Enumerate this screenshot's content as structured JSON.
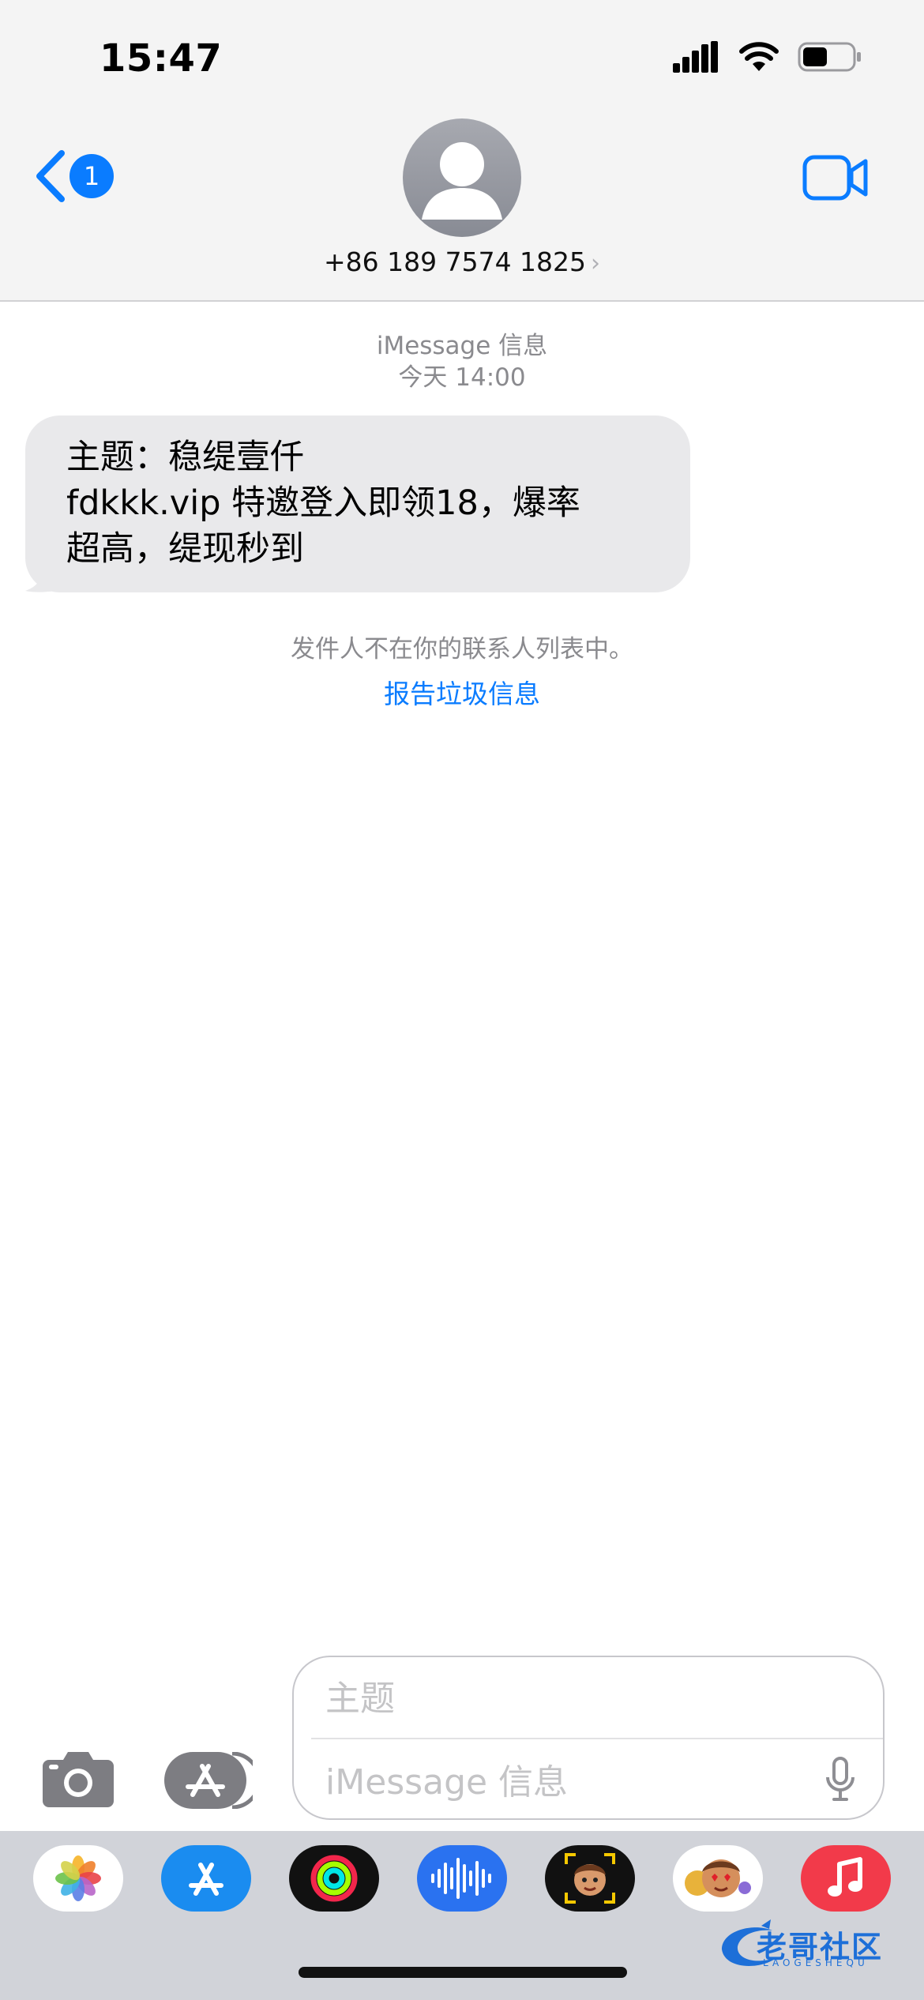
{
  "status": {
    "time": "15:47"
  },
  "nav": {
    "back_badge": "1",
    "contact_number": "+86 189 7574 1825",
    "chevron": "›"
  },
  "thread": {
    "service": "iMessage 信息",
    "timestamp": "今天 14:00",
    "message_lines": [
      "主题：稳缇壹仟",
      "fdkkk.vip 特邀登入即领18，爆率",
      "超高，缇现秒到"
    ],
    "sender_note": "发件人不在你的联系人列表中。",
    "report_link": "报告垃圾信息"
  },
  "compose": {
    "subject_placeholder": "主题",
    "message_placeholder": "iMessage 信息"
  },
  "app_drawer": [
    {
      "name": "photos-app-icon"
    },
    {
      "name": "app-store-icon"
    },
    {
      "name": "activity-icon"
    },
    {
      "name": "audio-message-icon"
    },
    {
      "name": "memoji-icon"
    },
    {
      "name": "animoji-stickers-icon"
    },
    {
      "name": "music-icon"
    }
  ],
  "watermark": {
    "text": "老哥社区",
    "subtext": "LAOGESHEQU"
  },
  "colors": {
    "accent": "#0a7cff",
    "bubble_received": "#e9e9eb",
    "header_bg": "#f4f4f4",
    "drawer_bg": "#d1d3d9"
  }
}
